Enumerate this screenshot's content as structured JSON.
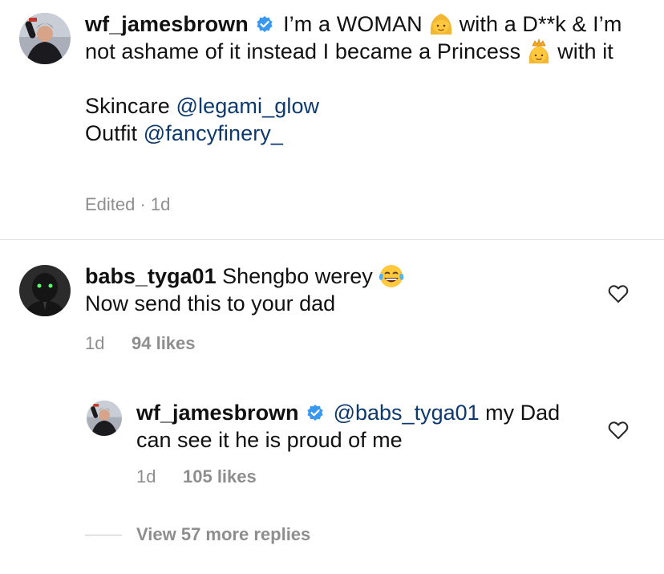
{
  "caption": {
    "username": "wf_jamesbrown",
    "text_part1": "I’m a WOMAN",
    "text_part2": "with a D**k & I’m not ashame of it instead I became a Princess",
    "text_part3": "with it",
    "skincare_label": "Skincare",
    "skincare_mention": "@legami_glow",
    "outfit_label": "Outfit",
    "outfit_mention": "@fancyfinery_",
    "edited_label": "Edited · 1d",
    "emoji_1": "woman-emoji",
    "emoji_2": "princess-emoji"
  },
  "comments": [
    {
      "username": "babs_tyga01",
      "text_part1": "Shengbo werey",
      "emoji": "tears-of-joy-emoji",
      "text_part2": "Now send this to your dad",
      "time": "1d",
      "likes": "94 likes"
    }
  ],
  "reply": {
    "username": "wf_jamesbrown",
    "mention": "@babs_tyga01",
    "text": "my Dad can see it he is proud of me",
    "time": "1d",
    "likes": "105 likes"
  },
  "view_replies_label": "View 57 more replies",
  "colors": {
    "verified": "#3897f0",
    "mention": "#0d3a6e",
    "meta": "#8e8e8e"
  }
}
